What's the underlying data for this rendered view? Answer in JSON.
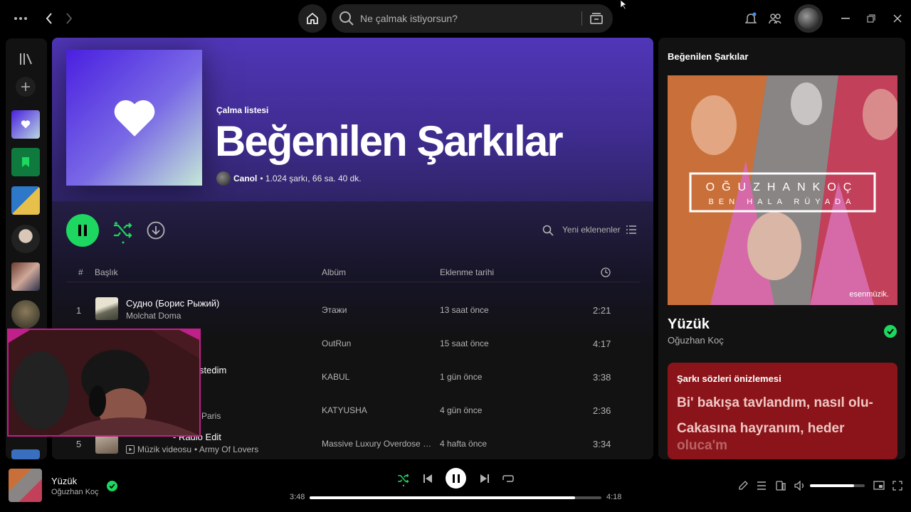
{
  "topbar": {
    "search_placeholder": "Ne çalmak istiyorsun?",
    "icons": [
      "more-icon",
      "back-icon",
      "forward-icon",
      "home-icon",
      "search-icon",
      "browse-icon",
      "bell-icon",
      "friends-icon",
      "avatar",
      "minimize-icon",
      "restore-icon",
      "close-icon"
    ]
  },
  "playlist": {
    "type_label": "Çalma listesi",
    "title": "Beğenilen Şarkılar",
    "owner": "Canol",
    "meta": "• 1.024 şarkı, 66 sa. 40 dk.",
    "sort_label": "Yeni eklenenler"
  },
  "table": {
    "headers": {
      "num": "#",
      "title": "Başlık",
      "album": "Albüm",
      "date": "Eklenme tarihi"
    },
    "rows": [
      {
        "num": "1",
        "title": "Судно (Борис Рыжий)",
        "artist": "Molchat Doma",
        "album": "Этажи",
        "date": "13 saat önce",
        "duration": "2:21"
      },
      {
        "num": "",
        "title": "",
        "artist": "",
        "album": "OutRun",
        "date": "15 saat önce",
        "duration": "4:17"
      },
      {
        "num": "",
        "title": "stedim",
        "artist": "",
        "album": "KABUL",
        "date": "1 gün önce",
        "duration": "3:38"
      },
      {
        "num": "",
        "title": "",
        "artist": "Paris",
        "album": "KATYUSHA",
        "date": "4 gün önce",
        "duration": "2:36"
      },
      {
        "num": "5",
        "title": "- Radio Edit",
        "artist_badge": "Müzik videosu",
        "artist": "• Army Of Lovers",
        "album": "Massive Luxury Overdose (...",
        "date": "4 hafta önce",
        "duration": "3:34"
      }
    ]
  },
  "now_playing_panel": {
    "header": "Beğenilen Şarkılar",
    "cover_artist_text": "OĞUZHANKOÇ",
    "cover_album_text": "BEN HALA RÜYADA",
    "cover_label": "esenmüzik.",
    "song": "Yüzük",
    "artist": "Oğuzhan Koç",
    "lyrics_header": "Şarkı sözleri önizlemesi",
    "lyrics_lines": [
      "Bi' bakışa tavlandım, nasıl olu-",
      "Cakasına hayranım, heder",
      "oluca'm"
    ]
  },
  "player": {
    "song": "Yüzük",
    "artist": "Oğuzhan Koç",
    "elapsed": "3:48",
    "total": "4:18",
    "progress": 0.91,
    "volume": 0.8
  },
  "colors": {
    "accent": "#1ed760",
    "hero": "#5036b8",
    "lyrics": "#8a1419"
  }
}
